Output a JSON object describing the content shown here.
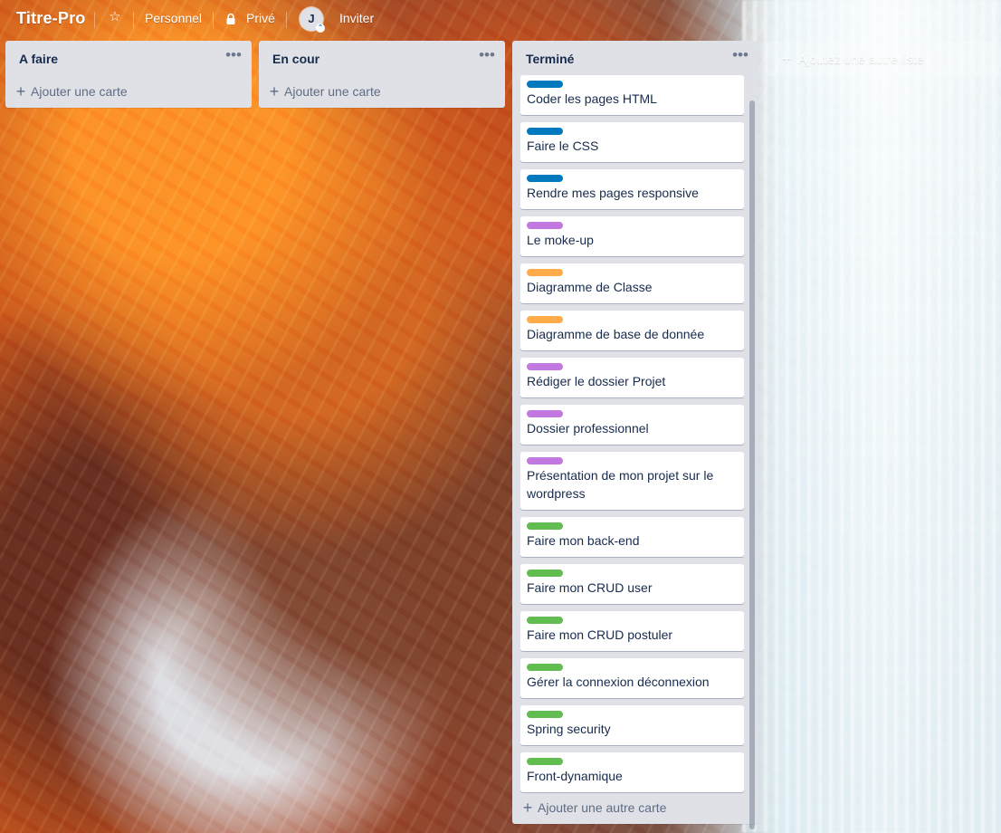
{
  "board": {
    "title": "Titre-Pro",
    "icons": {
      "star": "☆",
      "menu": "•••",
      "plus": "+"
    },
    "nav": {
      "personal_label": "Personnel",
      "privacy_label": "Privé",
      "avatar_initial": "J",
      "invite_label": "Inviter"
    }
  },
  "lists": [
    {
      "title": "A faire",
      "add_card_label": "Ajouter une carte"
    },
    {
      "title": "En cour",
      "add_card_label": "Ajouter une carte"
    },
    {
      "title": "Terminé",
      "add_card_label": "Ajouter une autre carte",
      "cards": [
        {
          "label_color": "#0079bf",
          "title": "Coder les pages HTML"
        },
        {
          "label_color": "#0079bf",
          "title": "Faire le CSS"
        },
        {
          "label_color": "#0079bf",
          "title": "Rendre mes pages responsive"
        },
        {
          "label_color": "#c377e0",
          "title": "Le moke-up"
        },
        {
          "label_color": "#ffab4a",
          "title": "Diagramme de Classe"
        },
        {
          "label_color": "#ffab4a",
          "title": "Diagramme de base de donnée"
        },
        {
          "label_color": "#c377e0",
          "title": "Rédiger le dossier Projet"
        },
        {
          "label_color": "#c377e0",
          "title": "Dossier professionnel"
        },
        {
          "label_color": "#c377e0",
          "title": "Présentation de mon projet sur le wordpress"
        },
        {
          "label_color": "#61bd4f",
          "title": "Faire mon back-end"
        },
        {
          "label_color": "#61bd4f",
          "title": "Faire mon CRUD user"
        },
        {
          "label_color": "#61bd4f",
          "title": "Faire mon CRUD postuler"
        },
        {
          "label_color": "#61bd4f",
          "title": "Gérer la connexion déconnexion"
        },
        {
          "label_color": "#61bd4f",
          "title": "Spring security"
        },
        {
          "label_color": "#61bd4f",
          "title": "Front-dynamique"
        }
      ]
    }
  ],
  "add_list_label": "Ajoutez une autre liste"
}
